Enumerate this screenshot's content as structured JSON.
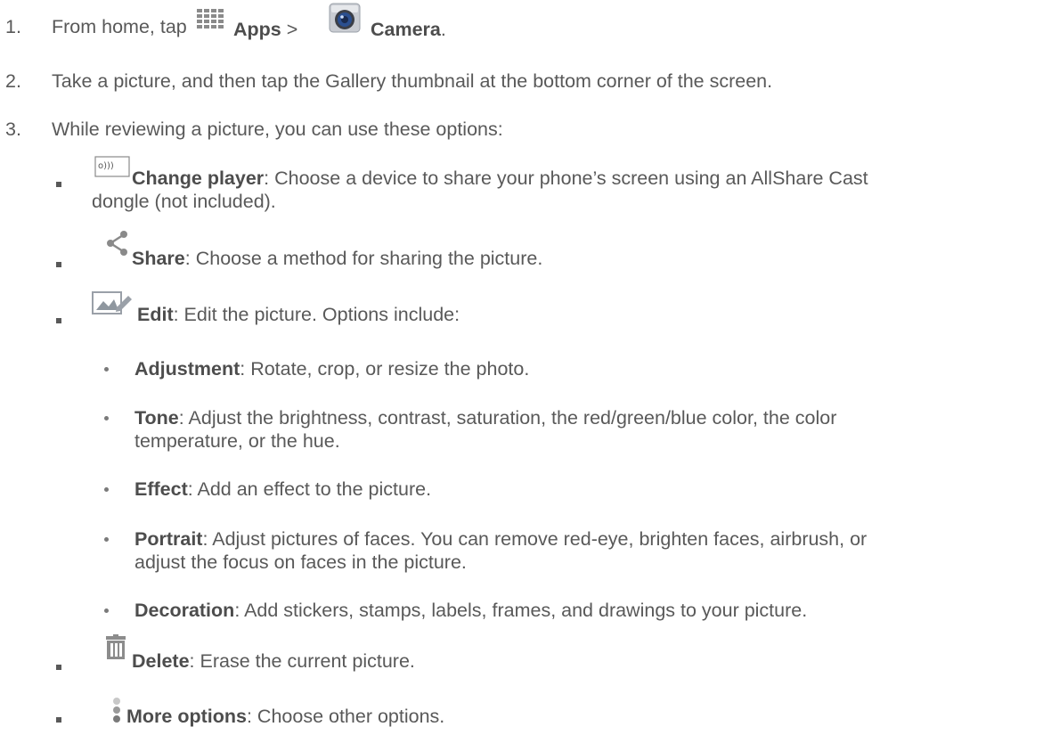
{
  "steps": [
    {
      "num": "1.",
      "prefix": "From home, tap",
      "apps": "Apps",
      "sep": ">",
      "camera": "Camera",
      "end": "."
    },
    {
      "num": "2.",
      "text": "Take a picture, and then tap the Gallery thumbnail at the bottom corner of the screen."
    },
    {
      "num": "3.",
      "text": "While reviewing a picture, you can use these options:"
    }
  ],
  "options": {
    "change_player": {
      "label": "Change player",
      "desc_line1": ": Choose a device to share your phone’s screen using an AllShare Cast",
      "desc_line2": "dongle (not included)."
    },
    "share": {
      "label": "Share",
      "desc": ": Choose a method for sharing the picture."
    },
    "edit": {
      "label": "Edit",
      "desc": ": Edit the picture. Options include:",
      "sub": [
        {
          "label": "Adjustment",
          "desc": ": Rotate, crop, or resize the photo."
        },
        {
          "label": "Tone",
          "desc": ": Adjust the brightness, contrast, saturation, the red/green/blue color, the color",
          "desc2": "temperature, or the hue."
        },
        {
          "label": "Effect",
          "desc": ": Add an effect to the picture."
        },
        {
          "label": "Portrait",
          "desc": ": Adjust pictures of faces. You can remove red-eye, brighten faces, airbrush, or",
          "desc2": "adjust the focus on faces in the picture."
        },
        {
          "label": "Decoration",
          "desc": ": Add stickers, stamps, labels, frames, and drawings to your picture."
        }
      ]
    },
    "delete": {
      "label": "Delete",
      "desc": ": Erase the current picture."
    },
    "more": {
      "label": "More options",
      "desc": ": Choose other options."
    }
  },
  "icons": {
    "apps": "apps-grid-icon",
    "camera": "camera-icon",
    "change_player": "change-player-icon",
    "share": "share-icon",
    "edit": "edit-picture-icon",
    "delete": "trash-icon",
    "more": "more-options-icon"
  },
  "colors": {
    "text": "#595959",
    "apps_icon": "#8a8a8a",
    "camera_lens": "#2b4f8f",
    "delete_icon": "#8c8c8c"
  }
}
